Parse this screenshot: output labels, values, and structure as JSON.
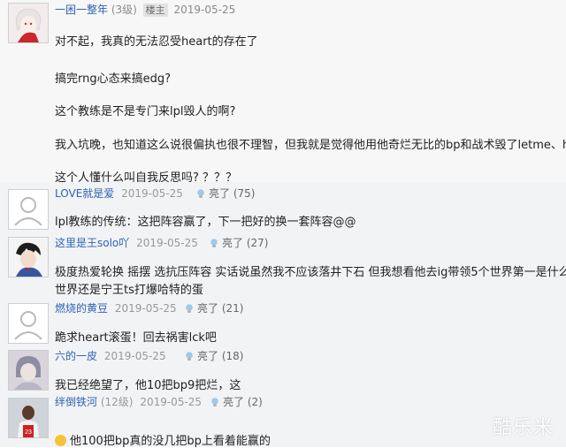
{
  "main_post": {
    "username": "一困一整年",
    "level": "(3级)",
    "badge": "楼主",
    "date": "2019-05-25",
    "lines": [
      "对不起，我真的无法忍受heart的存在了",
      "搞完rng心态来搞edg?",
      "这个教练是不是专门来lpl毁人的啊?",
      "我入坑晚，也知道这么说很偏执也很不理智，但我就是觉得他用他奇烂无比的bp和战术毁了letme、hard",
      "这个人懂什么叫自我反思吗? ？？？"
    ]
  },
  "replies": [
    {
      "username": "LOVE就是爱",
      "level": "",
      "date": "2019-05-25",
      "like_label": "亮了",
      "like_count": "(75)",
      "lines": [
        "lpl教练的传统：这把阵容赢了，下一把好的换一套阵容@@"
      ]
    },
    {
      "username": "这里是王solo吖",
      "level": "",
      "date": "2019-05-25",
      "like_label": "亮了",
      "like_count": "(27)",
      "lines": [
        "极度热爱轮换 摇摆 选抗压阵容 实话说虽然我不应该落井下石 但我想看他去ig带领5个世界第一是什么水",
        "世界还是宁王ts打爆哈特的蛋"
      ]
    },
    {
      "username": "燃烧的黄豆",
      "level": "",
      "date": "2019-05-25",
      "like_label": "亮了",
      "like_count": "(21)",
      "lines": [
        "跪求heart滚蛋！回去祸害lck吧"
      ]
    },
    {
      "username": "六的一皮",
      "level": "",
      "date": "2019-05-25",
      "like_label": "亮了",
      "like_count": "(18)",
      "lines": [
        "我已经绝望了，他10把bp9把烂，这"
      ]
    },
    {
      "username": "绊倒铁河",
      "level": "(12级)",
      "date": "2019-05-25",
      "like_label": "亮了",
      "like_count": "(2)",
      "lines": [
        "他100把bp真的没几把bp上看着能赢的"
      ]
    }
  ],
  "watermark": "酷乐米",
  "colors": {
    "username": "#2d64b3",
    "reply_bg": "#f2f3f5",
    "post_bg": "#f7f7f7"
  }
}
